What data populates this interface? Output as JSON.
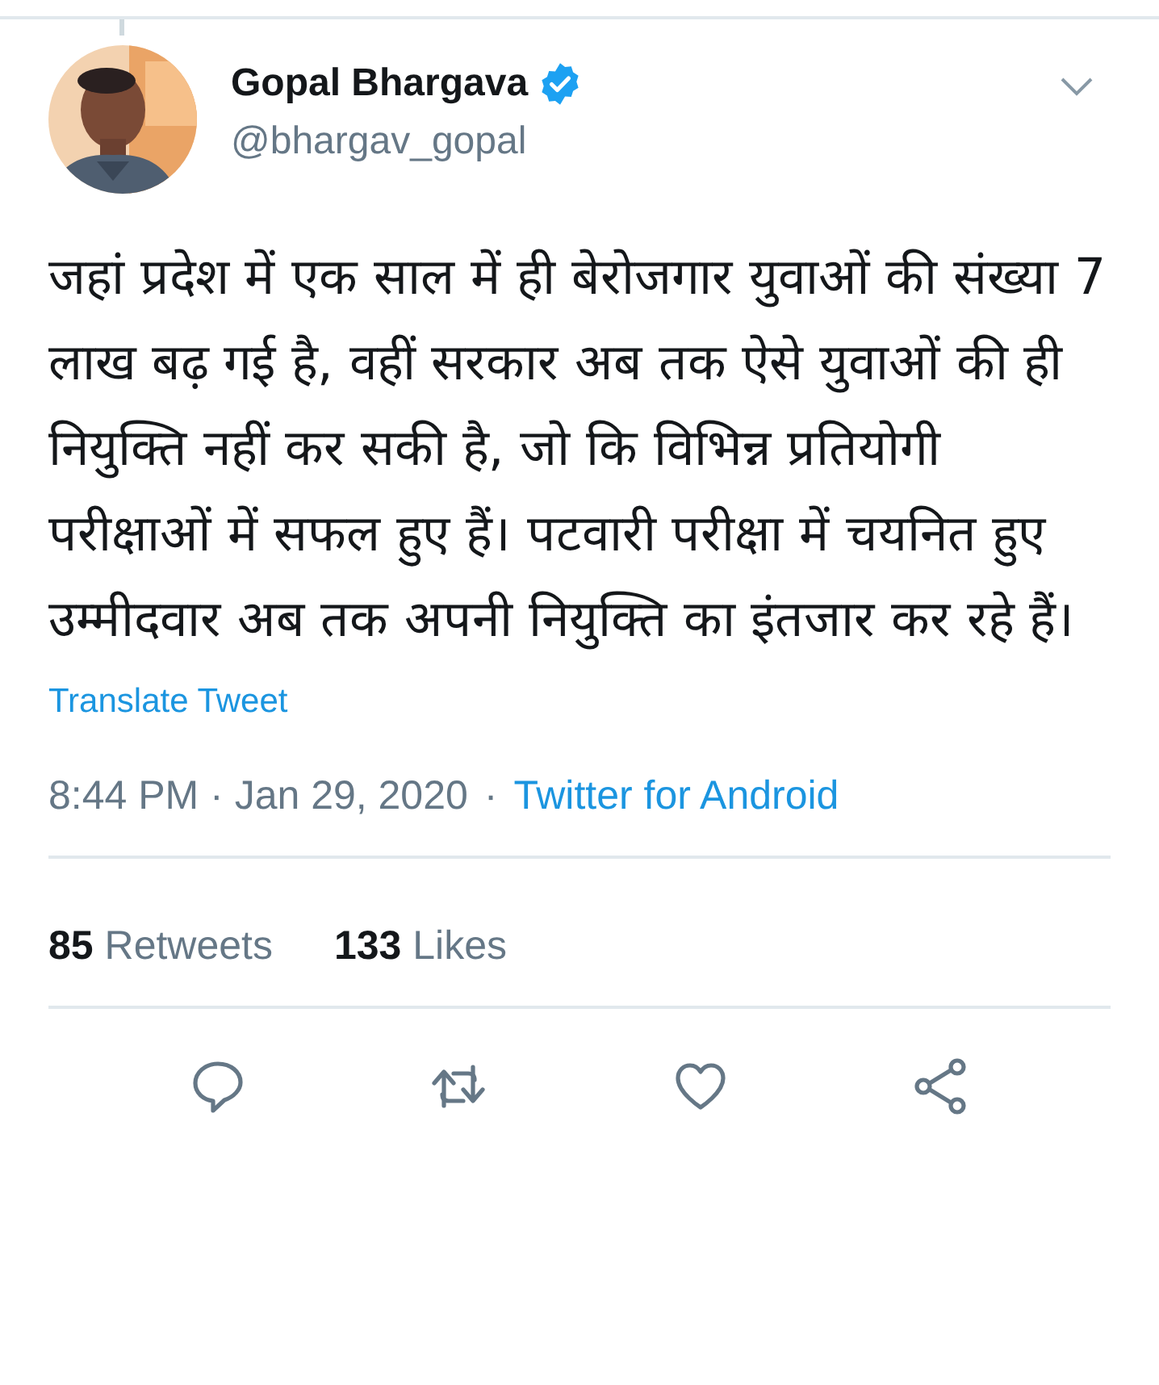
{
  "tweet": {
    "author": {
      "name": "Gopal Bhargava",
      "verified": true,
      "handle": "@bhargav_gopal"
    },
    "text": "जहां प्रदेश में एक साल में ही बेरोजगार युवाओं की संख्या 7 लाख बढ़ गई है, वहीं सरकार अब तक ऐसे युवाओं की ही नियुक्ति नहीं कर सकी है, जो कि विभिन्न प्रतियोगी परीक्षाओं में सफल हुए हैं। पटवारी परीक्षा में चयनित हुए उम्मीदवार अब तक अपनी नियुक्ति का इंतजार कर रहे हैं।",
    "translate_link": "Translate Tweet",
    "time": "8:44 PM · Jan 29, 2020",
    "separator": "·",
    "source": "Twitter for Android",
    "stats": [
      "**85** Retweets",
      "**133** Likes"
    ]
  }
}
